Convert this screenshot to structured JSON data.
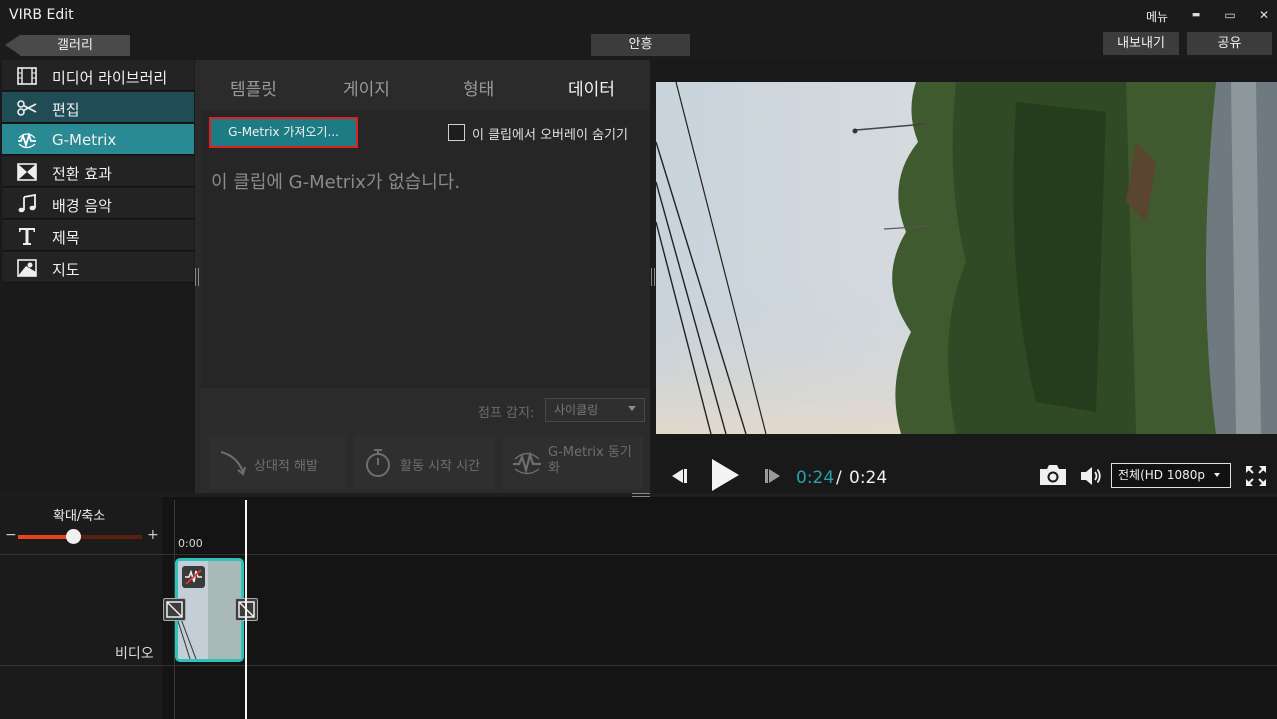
{
  "window": {
    "title": "VIRB Edit",
    "menu_label": "메뉴",
    "minimize_glyph": "▬",
    "maximize_glyph": "▭",
    "close_glyph": "✕"
  },
  "toolbar": {
    "gallery_label": "갤러리",
    "project_title": "안흥",
    "export_label": "내보내기",
    "share_label": "공유"
  },
  "sidebar": {
    "items": [
      {
        "label": "미디어 라이브러리",
        "icon": "film-icon"
      },
      {
        "label": "편집",
        "icon": "scissors-icon"
      },
      {
        "label": "G-Metrix",
        "icon": "gmetrix-icon"
      },
      {
        "label": "전환 효과",
        "icon": "transition-icon"
      },
      {
        "label": "배경 음악",
        "icon": "music-note-icon"
      },
      {
        "label": "제목",
        "icon": "title-t-icon"
      },
      {
        "label": "지도",
        "icon": "map-icon"
      }
    ]
  },
  "tabs": [
    {
      "label": "템플릿",
      "active": false
    },
    {
      "label": "게이지",
      "active": false
    },
    {
      "label": "형태",
      "active": false
    },
    {
      "label": "데이터",
      "active": true
    }
  ],
  "data_panel": {
    "import_button": "G-Metrix 가져오기...",
    "hide_overlay_label": "이 클립에서 오버레이 숨기기",
    "hide_overlay_checked": false,
    "empty_message": "이 클립에 G-Metrix가 없습니다.",
    "jump_detect_label": "점프 감지:",
    "jump_detect_value": "사이클링",
    "actions": [
      {
        "label": "상대적 해발",
        "icon": "elevation-icon"
      },
      {
        "label": "활동 시작 시간",
        "icon": "stopwatch-icon"
      },
      {
        "label": "G-Metrix 동기화",
        "icon": "gmetrix-sync-icon"
      }
    ]
  },
  "player": {
    "time_current": "0:24",
    "time_separator": "/",
    "time_total": "0:24",
    "quality": "전체(HD 1080p"
  },
  "timeline": {
    "zoom_label": "확대/축소",
    "zoom_minus": "−",
    "zoom_plus": "+",
    "zoom_level": 0.45,
    "ruler_start": "0:00",
    "video_track_label": "비디오"
  },
  "colors": {
    "accent": "#2a8a93",
    "active_edit": "#1f4c55",
    "highlight_border": "#e01f1f",
    "time_accent": "#2aa0aa",
    "zoom_fill": "#e8431c",
    "clip_border": "#2cc3bb"
  }
}
